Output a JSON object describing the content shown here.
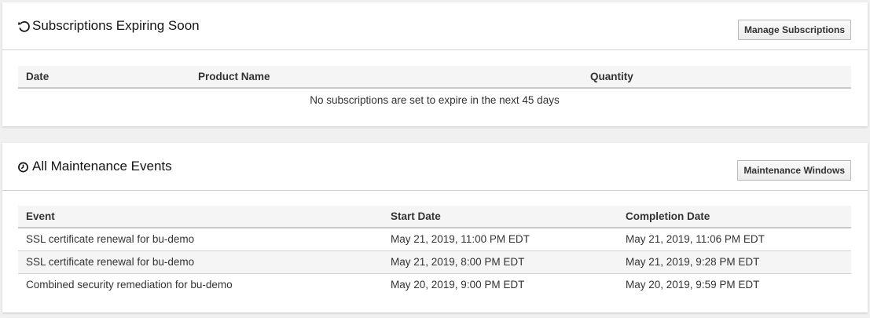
{
  "subscriptions": {
    "title": "Subscriptions Expiring Soon",
    "icon": "refresh-icon",
    "button_label": "Manage Subscriptions",
    "columns": [
      "Date",
      "Product Name",
      "Quantity"
    ],
    "empty_message": "No subscriptions are set to expire in the next 45 days"
  },
  "maintenance": {
    "title": "All Maintenance Events",
    "icon": "clock-icon",
    "button_label": "Maintenance Windows",
    "columns": [
      "Event",
      "Start Date",
      "Completion Date"
    ],
    "rows": [
      {
        "event": "SSL certificate renewal for bu-demo",
        "start": "May 21, 2019, 11:00 PM EDT",
        "end": "May 21, 2019, 11:06 PM EDT"
      },
      {
        "event": "SSL certificate renewal for bu-demo",
        "start": "May 21, 2019, 8:00 PM EDT",
        "end": "May 21, 2019, 9:28 PM EDT"
      },
      {
        "event": "Combined security remediation for bu-demo",
        "start": "May 20, 2019, 9:00 PM EDT",
        "end": "May 20, 2019, 9:59 PM EDT"
      }
    ]
  }
}
